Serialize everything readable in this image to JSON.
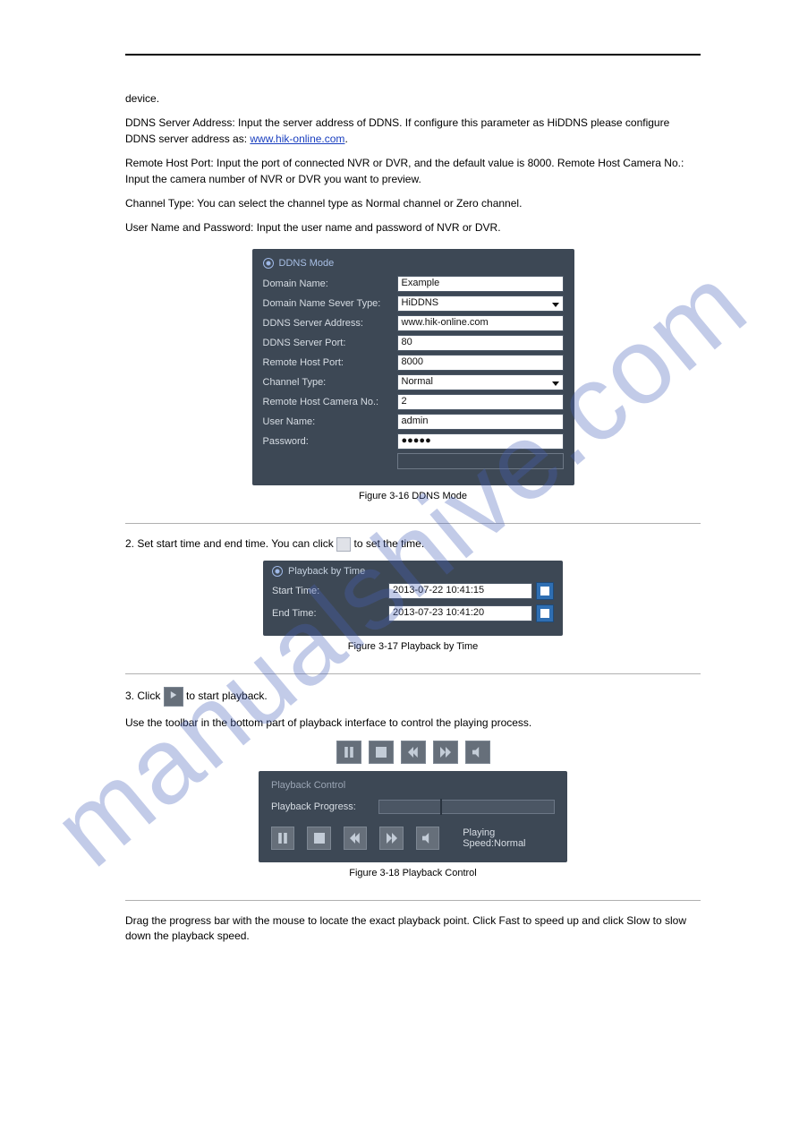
{
  "watermark": "manualshive.com",
  "body": {
    "para1": "device.",
    "para2a": "DDNS Server Address: Input the server address of DDNS. If configure this parameter as HiDDNS please configure DDNS server address as: ",
    "link": "www.hik-online.com",
    "para2b": ".",
    "para3": "Remote Host Port: Input the port of connected NVR or DVR, and the default value is 8000. Remote Host Camera No.: Input the camera number of NVR or DVR you want to preview.",
    "para4": "Channel Type: You can select the channel type as Normal channel or Zero channel.",
    "para5": "User Name and Password: Input the user name and password of NVR or DVR.",
    "step2a": "2. Set start time and end time. You can click",
    "step2b": "to set the time.",
    "step3a": "3. Click",
    "step3b": "to start playback.",
    "stepToolbar": "Use the toolbar in the bottom part of playback interface to control the playing process.",
    "footer": "Drag the progress bar with the mouse to locate the exact playback point. Click Fast to speed up and click Slow to slow down the playback speed."
  },
  "ddns": {
    "title": "DDNS Mode",
    "fields": [
      {
        "label": "Domain Name:",
        "value": "Example"
      },
      {
        "label": "Domain Name Sever Type:",
        "value": "HiDDNS"
      },
      {
        "label": "DDNS Server Address:",
        "value": "www.hik-online.com"
      },
      {
        "label": "DDNS Server Port:",
        "value": "80"
      },
      {
        "label": "Remote Host Port:",
        "value": "8000"
      },
      {
        "label": "Channel Type:",
        "value": "Normal"
      },
      {
        "label": "Remote Host Camera No.:",
        "value": "2"
      },
      {
        "label": "User Name:",
        "value": "admin"
      },
      {
        "label": "Password:",
        "value": "●●●●●"
      }
    ]
  },
  "playbackTime": {
    "title": "Playback by Time",
    "start": {
      "label": "Start Time:",
      "value": "2013-07-22 10:41:15"
    },
    "end": {
      "label": "End Time:",
      "value": "2013-07-23 10:41:20"
    }
  },
  "playbackControl": {
    "title": "Playback Control",
    "progressLabel": "Playback Progress:",
    "speed": "Playing Speed:Normal"
  },
  "captions": {
    "fig1": "Figure 3-16 DDNS Mode",
    "fig2": "Figure 3-17 Playback by Time",
    "fig3": "Figure 3-18 Playback Control"
  }
}
